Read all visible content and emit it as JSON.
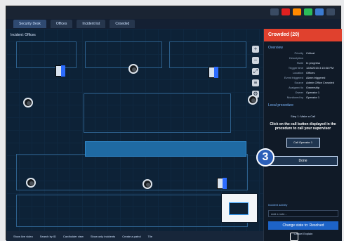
{
  "window": {
    "tabs": [
      {
        "label": "Security Desk",
        "active": true
      },
      {
        "label": "Offices"
      },
      {
        "label": "Incident list"
      },
      {
        "label": "Crowded"
      }
    ]
  },
  "map": {
    "header": "Incident: Offices",
    "bottom_bar": [
      "Show live video",
      "Search by ID",
      "Cardholder view",
      "Show only incidents",
      "Create a patrol",
      "Tile"
    ]
  },
  "incident_panel": {
    "title": "Crowded (20)",
    "overview_title": "Overview",
    "fields": [
      {
        "k": "Priority",
        "v": "Critical"
      },
      {
        "k": "Description",
        "v": ""
      },
      {
        "k": "State",
        "v": "In progress"
      },
      {
        "k": "Trigger time",
        "v": "12/8/2015 3:15:08 PM"
      },
      {
        "k": "Location",
        "v": "Offices"
      },
      {
        "k": "Event triggered",
        "v": "Alarm triggered"
      },
      {
        "k": "Source",
        "v": "Admin Office Crowded"
      },
      {
        "k": "Assigned to",
        "v": "Ownership"
      },
      {
        "k": "Owner",
        "v": "Operator 1"
      },
      {
        "k": "Monitored by",
        "v": "Operator 1"
      }
    ],
    "sop_title": "Local procedure",
    "step_label": "Step 1: Make a Call",
    "instruction": "Click on the call button displayed in the procedure to call your supervisor",
    "call_button": "Call Operator 1",
    "done_button": "Done",
    "activity_title": "Incident activity",
    "add_note_placeholder": "Add a note...",
    "change_state_button": "Change state to: Resolved",
    "cancel_label": "Cancel",
    "explain_label": "Explain"
  },
  "badge": {
    "number": "3"
  }
}
